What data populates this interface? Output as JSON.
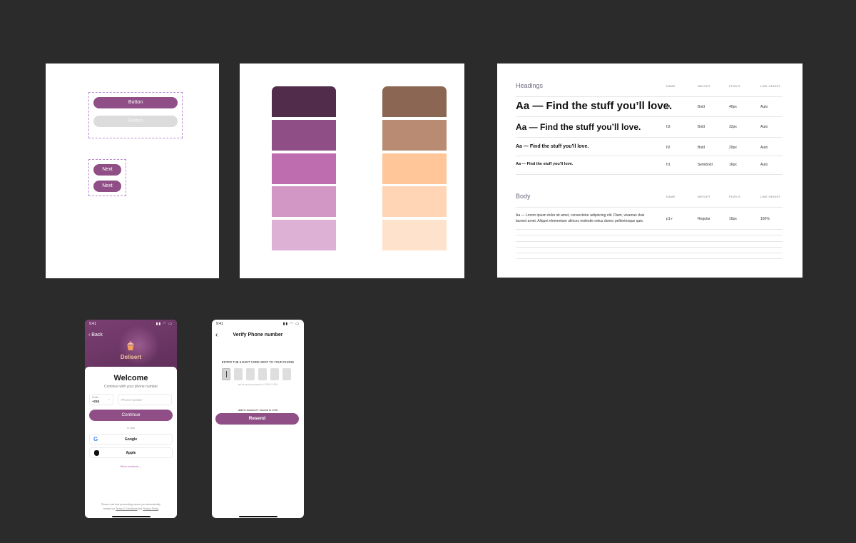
{
  "buttons_frame": {
    "primary_button_label": "Button",
    "disabled_button_label": "Button",
    "next_button_1_label": "Next",
    "next_button_2_label": "Next"
  },
  "palette": {
    "purple": [
      "#512c4b",
      "#8f4f86",
      "#be6daf",
      "#d397c6",
      "#dcb1d5"
    ],
    "peach": [
      "#8b6753",
      "#b88b72",
      "#ffc799",
      "#ffd5b5",
      "#ffe2cc"
    ]
  },
  "typography": {
    "headings_title": "Headings",
    "body_title": "Body",
    "columns": [
      "NAME",
      "WEIGHT",
      "PIXELS",
      "LINE HEIGHT"
    ],
    "heading_rows": [
      {
        "sample": "Aa — Find the stuff you’ll love.",
        "name": "h4",
        "weight": "Bold",
        "pixels": "40px",
        "line_height": "Auto"
      },
      {
        "sample": "Aa — Find the stuff you’ll love.",
        "name": "h3",
        "weight": "Bold",
        "pixels": "32px",
        "line_height": "Auto"
      },
      {
        "sample": "Aa — Find the stuff you’ll love.",
        "name": "h2",
        "weight": "Bold",
        "pixels": "20px",
        "line_height": "Auto"
      },
      {
        "sample": "Aa — Find the stuff you’ll love.",
        "name": "h1",
        "weight": "Semibold",
        "pixels": "16px",
        "line_height": "Auto"
      }
    ],
    "body_row": {
      "sample_line1": "Aa — Lorem ipsum dolor sit amet, consectetur adipiscing elit. Diam, vivamus duis",
      "sample_line2": "laoreet amet. Aliquet elementum ultrices molestie netus donec pellentesque quis.",
      "name": "p1-r",
      "weight": "Regular",
      "pixels": "16px",
      "line_height": "150%"
    }
  },
  "login_screen": {
    "time": "9:41",
    "back_label": "Back",
    "brand": "Delisert",
    "welcome": "Welcome",
    "subtitle": "Continue with your phone number",
    "prefix_label": "Prefix",
    "prefix_value": "+234",
    "phone_placeholder": "Phone number",
    "continue_label": "Continue",
    "or_with": "or with",
    "google_label": "Google",
    "apple_label": "Apple",
    "other_methods": "Other methods",
    "legal_line1": "Please note that proceeding means you automatically",
    "legal_prefix": "accept our",
    "terms_label": "Terms & Conditions",
    "legal_and": "and",
    "privacy_label": "Privacy Policy"
  },
  "verify_screen": {
    "time": "9:41",
    "title": "Verify Phone number",
    "instruction": "ENTER THE 6-DIGIT CODE SENT TO YOUR PHONE",
    "sent_to": "we've sent you sms to +234*****234",
    "resend_timer": "didn't receive it? resend in 0:00",
    "resend_label": "Resend"
  },
  "colors": {
    "accent": "#8f4f86",
    "canvas": "#2b2b2b"
  }
}
